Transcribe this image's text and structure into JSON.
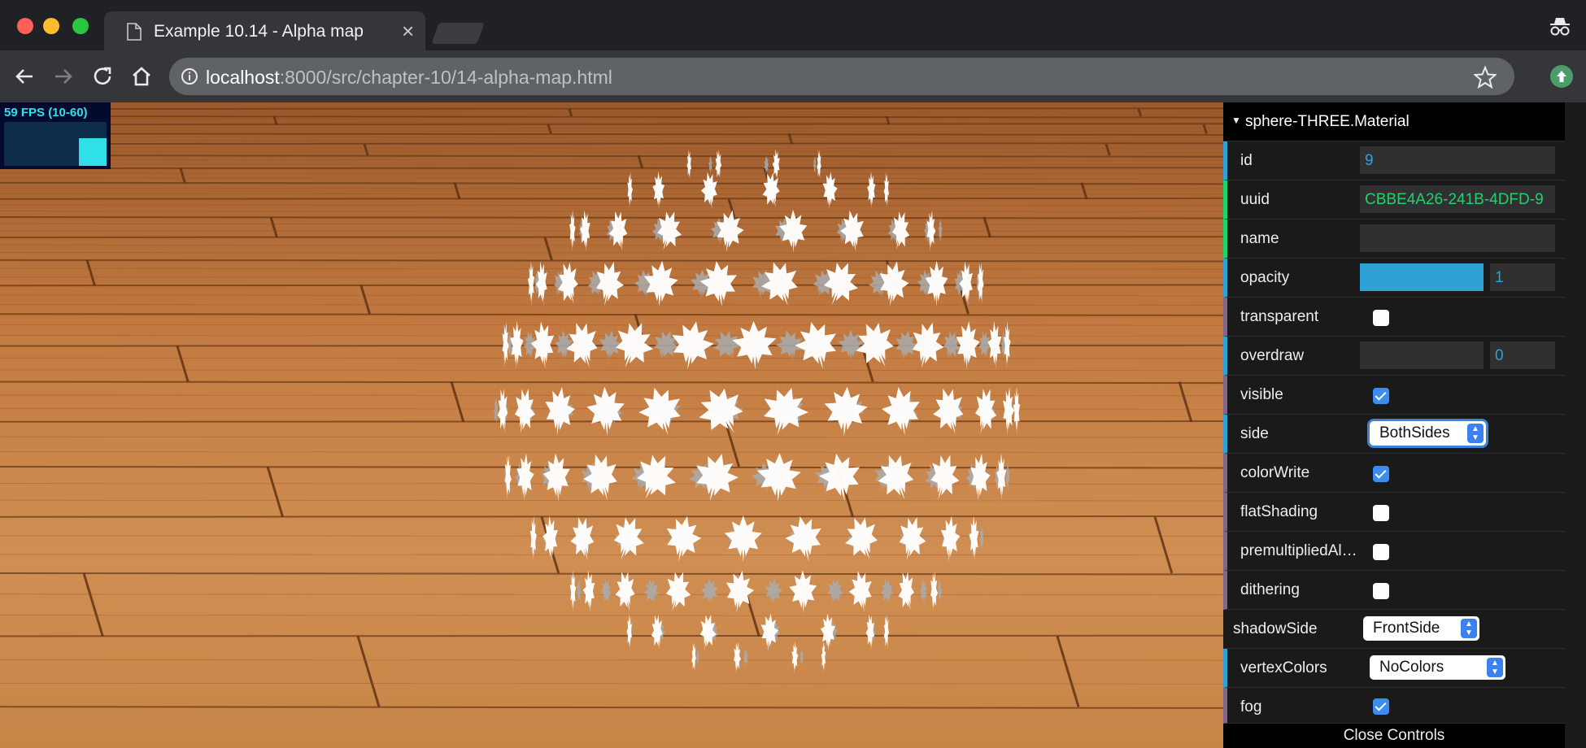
{
  "browser": {
    "tab_title": "Example 10.14 - Alpha map",
    "tab_close": "×",
    "url_host": "localhost",
    "url_path": ":8000/src/chapter-10/14-alpha-map.html",
    "icons": [
      "back-icon",
      "forward-icon",
      "reload-icon",
      "home-icon",
      "info-icon",
      "star-icon",
      "incognito-icon",
      "extension-icon"
    ]
  },
  "stats": {
    "label": "59 FPS (10-60)"
  },
  "gui": {
    "folder": "sphere-THREE.Material",
    "id_label": "id",
    "id_value": "9",
    "uuid_label": "uuid",
    "uuid_value": "CBBE4A26-241B-4DFD-9",
    "name_label": "name",
    "name_value": "",
    "opacity_label": "opacity",
    "opacity_value": "1",
    "opacity_fraction": 1,
    "transparent_label": "transparent",
    "transparent_checked": false,
    "overdraw_label": "overdraw",
    "overdraw_value": "0",
    "visible_label": "visible",
    "visible_checked": true,
    "side_label": "side",
    "side_value": "BothSides",
    "colorWrite_label": "colorWrite",
    "colorWrite_checked": true,
    "flatShading_label": "flatShading",
    "flatShading_checked": false,
    "premultiplied_label": "premultipliedAlpha",
    "premultiplied_checked": false,
    "dithering_label": "dithering",
    "dithering_checked": false,
    "shadowSide_label": "shadowSide",
    "shadowSide_value": "FrontSide",
    "vertexColors_label": "vertexColors",
    "vertexColors_value": "NoColors",
    "fog_label": "fog",
    "fog_checked": true,
    "close_label": "Close Controls"
  },
  "colors": {
    "accent_number": "#2fa1d6",
    "accent_string": "#1ed36f",
    "accent_bool": "#806787",
    "checkbox_checked": "#3b8ef0",
    "fps_cyan": "#2fe0e8"
  }
}
